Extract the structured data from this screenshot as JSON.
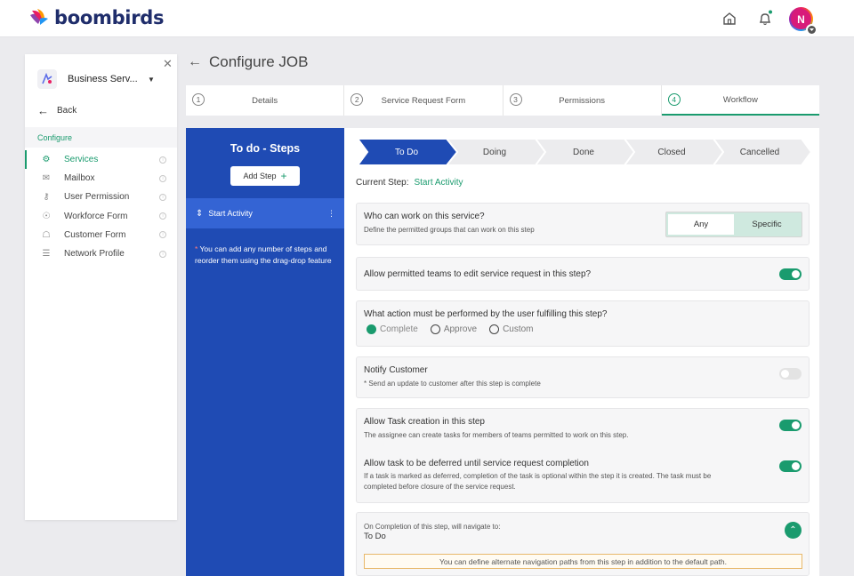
{
  "header": {
    "brand": "boombirds",
    "avatar_initial": "N",
    "colors": {
      "brand": "#1f2d6b",
      "accent": "#1a9b6e",
      "steps_panel": "#1f4bb4"
    }
  },
  "sidebar": {
    "workspace": "Business Serv...",
    "back_label": "Back",
    "section_label": "Configure",
    "items": [
      {
        "label": "Services",
        "icon": "services-icon",
        "active": true
      },
      {
        "label": "Mailbox",
        "icon": "mailbox-icon"
      },
      {
        "label": "User Permission",
        "icon": "key-icon"
      },
      {
        "label": "Workforce Form",
        "icon": "workforce-icon"
      },
      {
        "label": "Customer Form",
        "icon": "customer-icon"
      },
      {
        "label": "Network Profile",
        "icon": "document-icon"
      }
    ]
  },
  "page": {
    "title": "Configure JOB"
  },
  "tabs": [
    {
      "num": "1",
      "label": "Details"
    },
    {
      "num": "2",
      "label": "Service Request Form"
    },
    {
      "num": "3",
      "label": "Permissions"
    },
    {
      "num": "4",
      "label": "Workflow",
      "active": true
    }
  ],
  "steps_panel": {
    "title": "To do - Steps",
    "add_label": "Add Step",
    "add_plus": "+",
    "item_label": "Start Activity",
    "note_asterisk": "*",
    "note": " You can add any number of steps and reorder them using the drag-drop feature"
  },
  "flow": {
    "steps": [
      "To Do",
      "Doing",
      "Done",
      "Closed",
      "Cancelled"
    ],
    "active_index": 0
  },
  "current_step": {
    "label": "Current Step:",
    "value": "Start Activity"
  },
  "who_can_work": {
    "title": "Who can work on this service?",
    "subtitle": "Define the permitted groups that can work on this step",
    "options": [
      "Any",
      "Specific"
    ],
    "selected": "Any"
  },
  "allow_edit": {
    "title": "Allow permitted teams to edit service request in this step?",
    "enabled": true
  },
  "action": {
    "title": "What action must be performed by the user fulfilling this step?",
    "options": [
      "Complete",
      "Approve",
      "Custom"
    ],
    "selected": "Complete"
  },
  "notify": {
    "title": "Notify Customer",
    "subtitle": "* Send an update to customer after this step is complete",
    "enabled": false
  },
  "task_creation": {
    "title": "Allow Task creation in this step",
    "subtitle": "The assignee can create tasks for members of teams permitted to work on this step.",
    "enabled": true
  },
  "task_deferred": {
    "title": "Allow task to be deferred until service request completion",
    "subtitle": "If a task is marked as deferred, completion of the task is optional within the step it is created. The task must be completed before closure of the service request.",
    "enabled": true
  },
  "completion": {
    "label": "On Completion of this step, will navigate to:",
    "target": "To Do",
    "banner": "You can define alternate navigation paths from this step in addition to the default path."
  }
}
